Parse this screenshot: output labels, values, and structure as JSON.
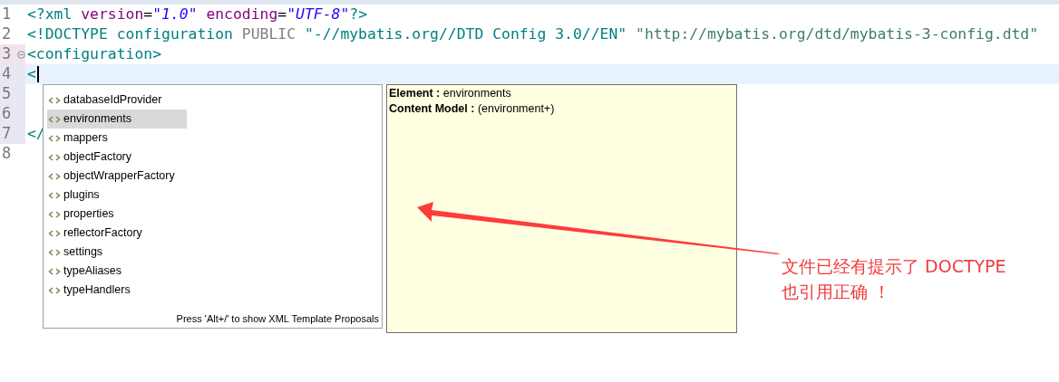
{
  "editor": {
    "lines": [
      {
        "number": "1",
        "highlighted": false,
        "folding": false,
        "segments": [
          {
            "kind": "tag",
            "text": "<?xml"
          },
          {
            "kind": "attr",
            "text": " version"
          },
          {
            "kind": "plain",
            "text": "="
          },
          {
            "kind": "value",
            "text": "\"1.0\""
          },
          {
            "kind": "attr",
            "text": " encoding"
          },
          {
            "kind": "plain",
            "text": "="
          },
          {
            "kind": "value",
            "text": "\"UTF-8\""
          },
          {
            "kind": "tag",
            "text": "?>"
          }
        ]
      },
      {
        "number": "2",
        "highlighted": false,
        "folding": false,
        "segments": [
          {
            "kind": "tag",
            "text": "<!DOCTYPE configuration"
          },
          {
            "kind": "keyword",
            "text": " PUBLIC"
          },
          {
            "kind": "tag",
            "text": " \"-//mybatis.org//DTD Config 3.0//EN\""
          },
          {
            "kind": "uri",
            "text": " \"http://mybatis.org/dtd/mybatis-3-config.dtd\""
          }
        ]
      },
      {
        "number": "3",
        "highlighted": false,
        "folding": true,
        "segments": [
          {
            "kind": "tag",
            "text": "<configuration>"
          }
        ]
      },
      {
        "number": "4",
        "highlighted": true,
        "folding": false,
        "segments": [
          {
            "kind": "tag",
            "text": "<"
          }
        ]
      },
      {
        "number": "5",
        "highlighted": false,
        "folding": false
      },
      {
        "number": "6",
        "highlighted": false,
        "folding": false
      },
      {
        "number": "7",
        "highlighted": false,
        "folding": false,
        "segments": [
          {
            "kind": "tag",
            "text": "</"
          }
        ]
      },
      {
        "number": "8",
        "highlighted": false,
        "folding": false
      }
    ]
  },
  "proposals": {
    "items": [
      {
        "label": "databaseIdProvider",
        "selected": false
      },
      {
        "label": "environments",
        "selected": true
      },
      {
        "label": "mappers",
        "selected": false
      },
      {
        "label": "objectFactory",
        "selected": false
      },
      {
        "label": "objectWrapperFactory",
        "selected": false
      },
      {
        "label": "plugins",
        "selected": false
      },
      {
        "label": "properties",
        "selected": false
      },
      {
        "label": "reflectorFactory",
        "selected": false
      },
      {
        "label": "settings",
        "selected": false
      },
      {
        "label": "typeAliases",
        "selected": false
      },
      {
        "label": "typeHandlers",
        "selected": false
      }
    ],
    "hint": "Press 'Alt+/' to show XML Template Proposals"
  },
  "info": {
    "rows": [
      {
        "label": "Element :",
        "value": "environments"
      },
      {
        "label": "Content Model :",
        "value": "(environment+)"
      }
    ]
  },
  "annotation": {
    "lines": [
      "文件已经有提示了 DOCTYPE",
      "也引用正确 ！"
    ]
  }
}
